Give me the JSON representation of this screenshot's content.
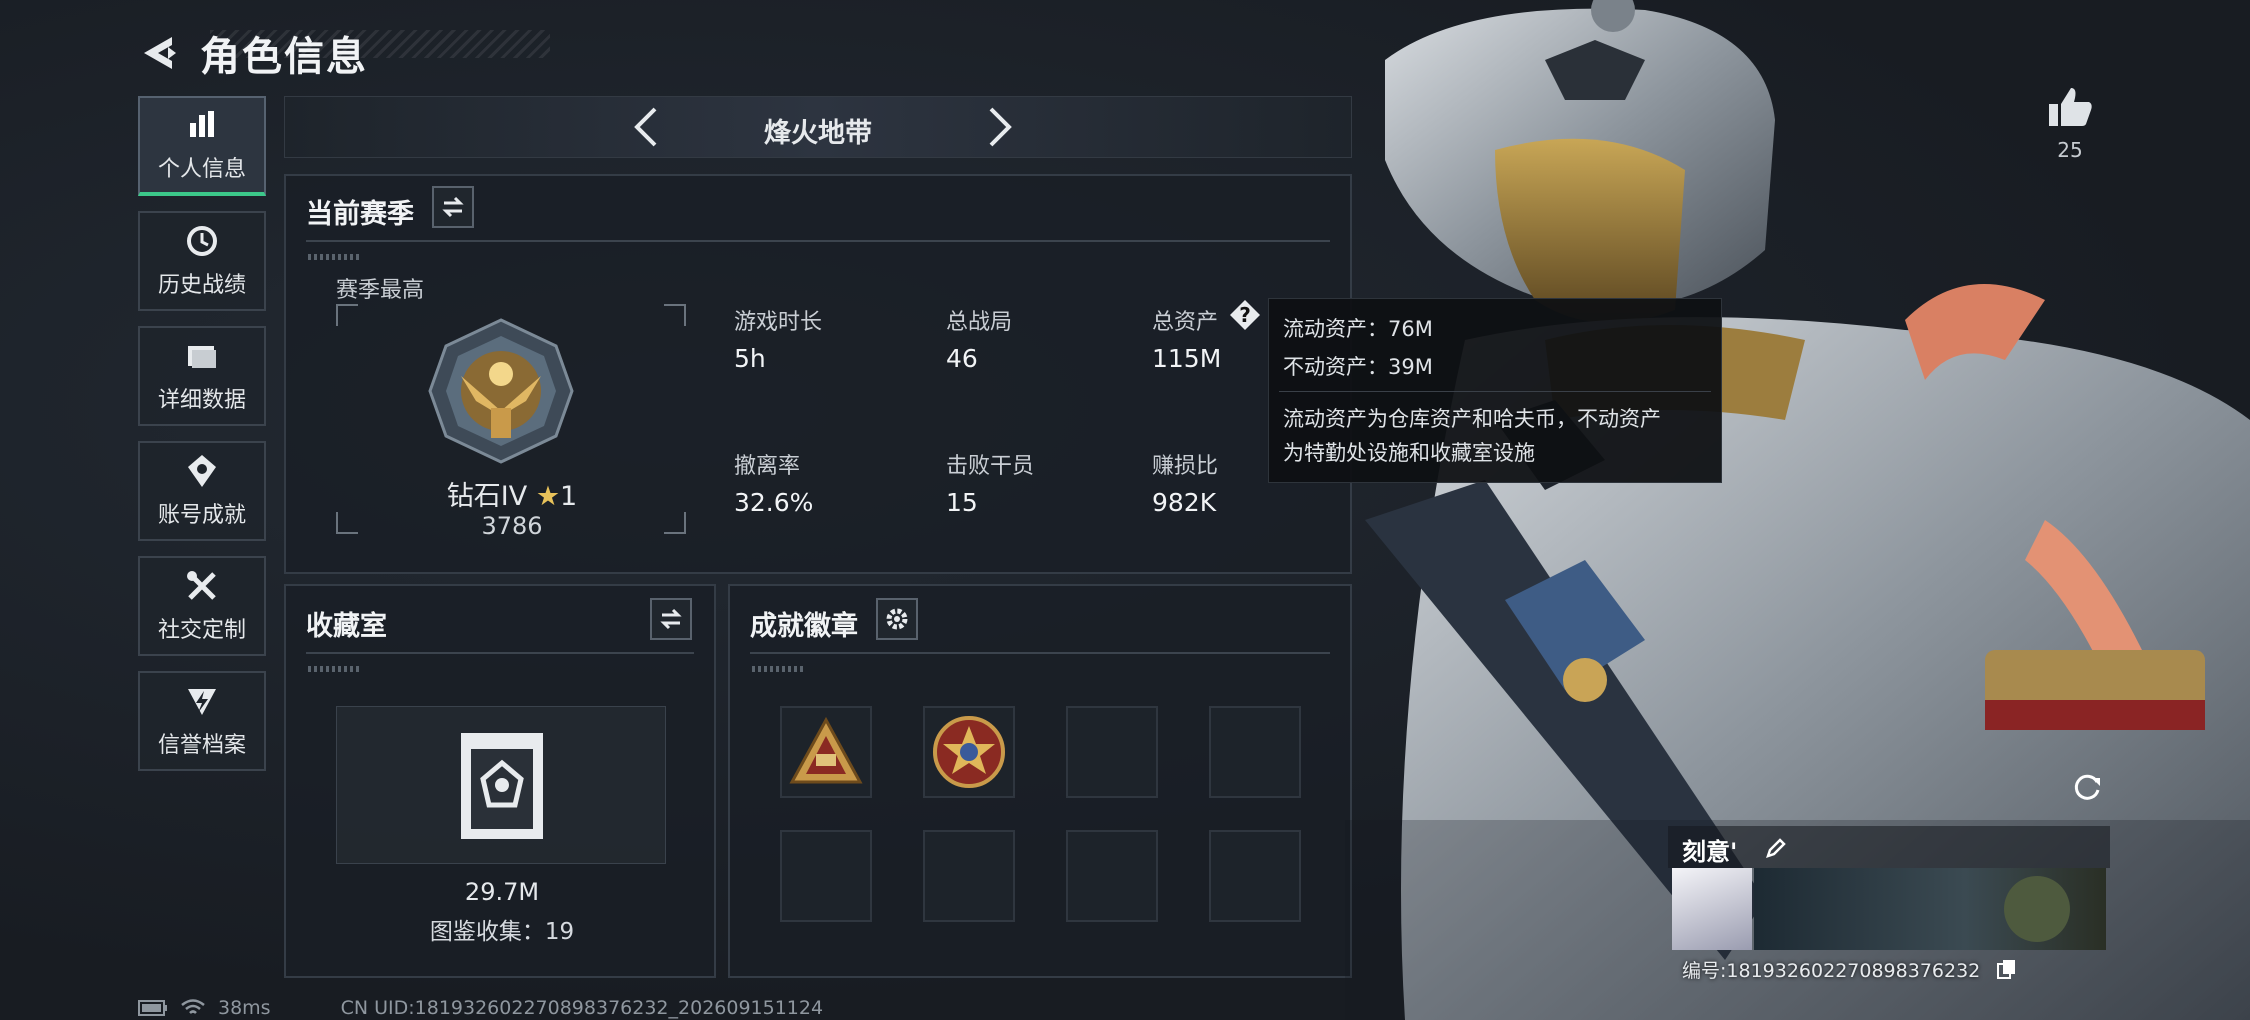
{
  "header": {
    "title": "角色信息"
  },
  "sidebar": {
    "items": [
      {
        "label": "个人信息",
        "icon": "bar-chart-icon",
        "active": true
      },
      {
        "label": "历史战绩",
        "icon": "history-clock-icon",
        "active": false
      },
      {
        "label": "详细数据",
        "icon": "folder-icon",
        "active": false
      },
      {
        "label": "账号成就",
        "icon": "medal-icon",
        "active": false
      },
      {
        "label": "社交定制",
        "icon": "wrench-icon",
        "active": false
      },
      {
        "label": "信誉档案",
        "icon": "shield-lightning-icon",
        "active": false
      }
    ]
  },
  "mode_selector": {
    "label": "烽火地带"
  },
  "season": {
    "title": "当前赛季",
    "best_label": "赛季最高",
    "rank_name": "钻石IV",
    "rank_stars": "1",
    "rank_score": "3786",
    "stats": [
      {
        "label": "游戏时长",
        "value": "5h"
      },
      {
        "label": "总战局",
        "value": "46"
      },
      {
        "label": "总资产",
        "value": "115M"
      },
      {
        "label": "撤离率",
        "value": "32.6%"
      },
      {
        "label": "击败干员",
        "value": "15"
      },
      {
        "label": "赚损比",
        "value": "982K"
      }
    ]
  },
  "asset_tooltip": {
    "liquid": "流动资产：76M",
    "fixed": "不动资产：39M",
    "desc_line1": "流动资产为仓库资产和哈夫币，不动资产",
    "desc_line2": "为特勤处设施和收藏室设施"
  },
  "collection": {
    "title": "收藏室",
    "value": "29.7M",
    "count_text": "图鉴收集：19"
  },
  "achievements": {
    "title": "成就徽章",
    "slots_filled": 2,
    "slots_total": 8
  },
  "likes": {
    "count": "25"
  },
  "player": {
    "name": "刻意'",
    "id_text": "编号:18193260227089837623​2"
  },
  "status_bar": {
    "ping": "38ms",
    "uid": "CN UID:18193260227089837623​2_202609151124"
  },
  "colors": {
    "accent_green": "#3cc88a",
    "panel_border": "#343c46",
    "background": "#1a1f26"
  }
}
